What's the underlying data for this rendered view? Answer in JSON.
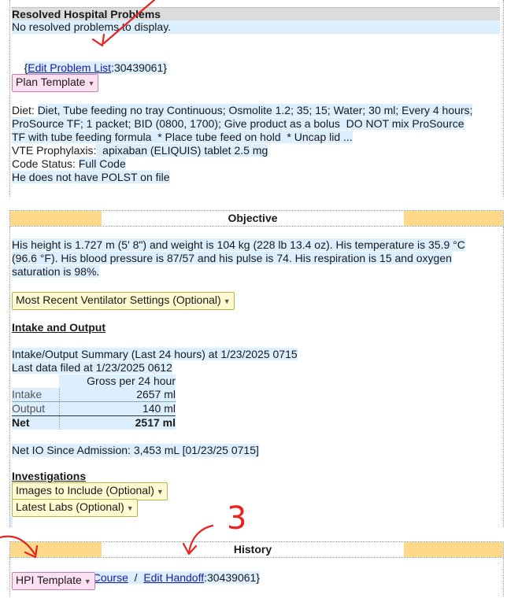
{
  "problems": {
    "heading": "Resolved Hospital Problems",
    "empty_text": "No resolved problems to display.",
    "brace_open": "{",
    "edit_link": "Edit Problem List",
    "id_suffix": ":30439061}"
  },
  "plan_template": "Plan Template",
  "diet": {
    "label": "Diet: ",
    "line1": "Diet, Tube feeding no tray Continuous; Osmolite 1.2; 35; 15; Water; 30 ml; Every 4 hours;",
    "line2": "ProSource TF; 1 packet; BID (0800, 1700); Give product as a bolus  DO NOT mix ProSource",
    "line3": "TF with tube feeding formula  * Place tube feed on hold  * Uncap lid ..."
  },
  "vte": {
    "label": "VTE Prophylaxis:",
    "value": "  apixaban (ELIQUIS) tablet 2.5 mg"
  },
  "code_status": {
    "label": "Code Status: ",
    "value": "Full Code"
  },
  "polst": "He does not have POLST on file",
  "objective": {
    "title": "Objective",
    "vitals1": "His height is 1.727 m (5' 8\") and weight is 104 kg (228 lb 13.4 oz). His temperature is 35.9 °C",
    "vitals2": "(96.6 °F). His blood pressure is 87/57 and his pulse is 74. His respiration is 15 and oxygen",
    "vitals3": "saturation is 98%.",
    "ventilator_dropdown": "Most Recent Ventilator Settings (Optional)",
    "io_heading": "Intake and Output",
    "io_summary": "Intake/Output Summary (Last 24 hours) at 1/23/2025 0715",
    "io_filed": "Last data filed at 1/23/2025 0612",
    "io_col": "Gross per 24 hour",
    "io_rows": [
      {
        "label": "Intake",
        "value": "2657 ml"
      },
      {
        "label": "Output",
        "value": "140 ml"
      },
      {
        "label": "Net",
        "value": "2517 ml"
      }
    ],
    "net_io": "Net IO Since Admission: 3,453 mL [01/23/25 0715]",
    "investigations_heading": "Investigations",
    "images_dropdown": "Images to Include (Optional)",
    "labs_dropdown": "Latest Labs (Optional)"
  },
  "history": {
    "title": "History",
    "brace_open": "{",
    "edit_course": "Edit Hospital Course",
    "sep": "  /  ",
    "edit_handoff": "Edit Handoff",
    "id_suffix": ":30439061}",
    "hpi_template": "HPI Template"
  },
  "annotations": {
    "number_label": "3",
    "ink_color": "#e8231f"
  }
}
